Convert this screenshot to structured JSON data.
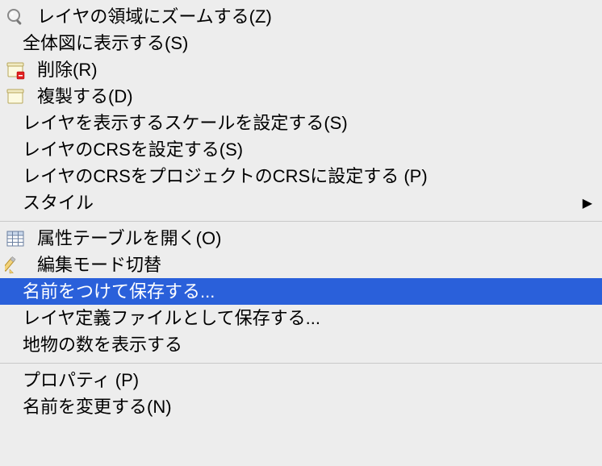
{
  "menu": {
    "group1": [
      {
        "label": "レイヤの領域にズームする(Z)",
        "icon": "zoom"
      },
      {
        "label": "全体図に表示する(S)",
        "icon": null
      },
      {
        "label": "削除(R)",
        "icon": "delete-layer"
      },
      {
        "label": "複製する(D)",
        "icon": "duplicate-layer"
      },
      {
        "label": "レイヤを表示するスケールを設定する(S)",
        "icon": null
      },
      {
        "label": "レイヤのCRSを設定する(S)",
        "icon": null
      },
      {
        "label": "レイヤのCRSをプロジェクトのCRSに設定する (P)",
        "icon": null
      },
      {
        "label": "スタイル",
        "icon": null,
        "submenu": true
      }
    ],
    "group2": [
      {
        "label": "属性テーブルを開く(O)",
        "icon": "table"
      },
      {
        "label": "編集モード切替",
        "icon": "pencil"
      },
      {
        "label": "名前をつけて保存する...",
        "icon": null,
        "highlight": true
      },
      {
        "label": "レイヤ定義ファイルとして保存する...",
        "icon": null
      },
      {
        "label": "地物の数を表示する",
        "icon": null
      }
    ],
    "group3": [
      {
        "label": "プロパティ (P)",
        "icon": null
      },
      {
        "label": "名前を変更する(N)",
        "icon": null
      }
    ]
  }
}
